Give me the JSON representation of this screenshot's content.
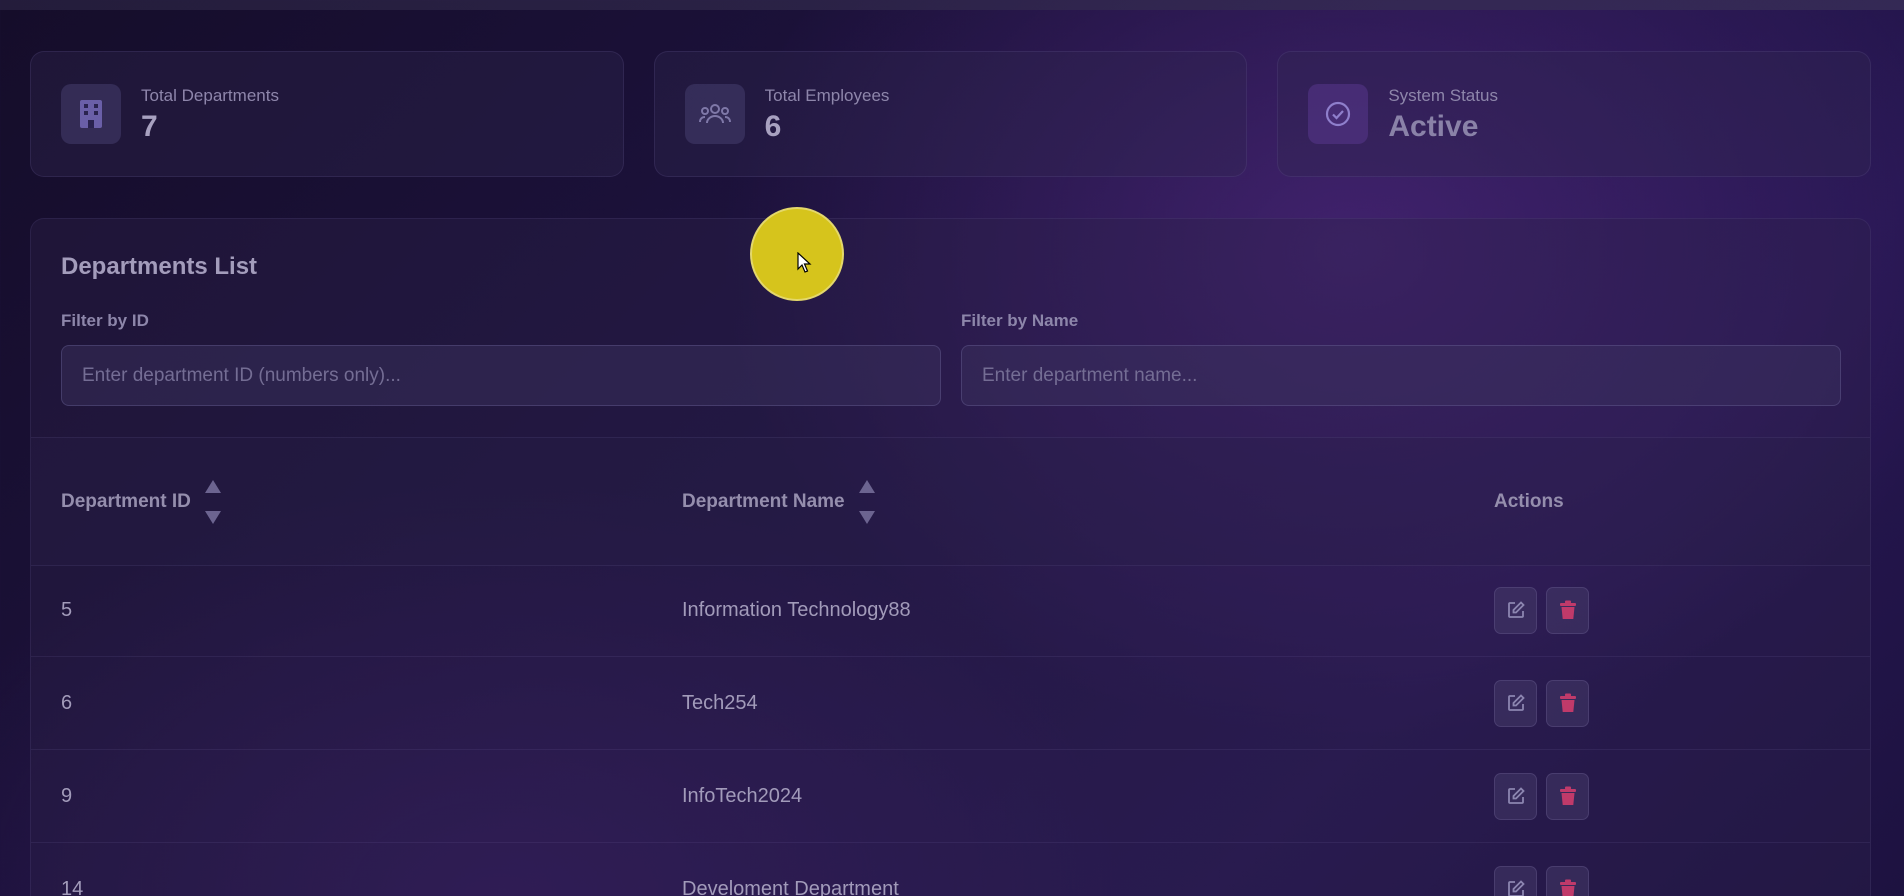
{
  "stats": [
    {
      "label": "Total Departments",
      "value": "7",
      "icon": "building-icon"
    },
    {
      "label": "Total Employees",
      "value": "6",
      "icon": "users-icon"
    },
    {
      "label": "System Status",
      "value": "Active",
      "icon": "check-circle-icon"
    }
  ],
  "panel": {
    "title": "Departments List",
    "filter_id_label": "Filter by ID",
    "filter_id_placeholder": "Enter department ID (numbers only)...",
    "filter_name_label": "Filter by Name",
    "filter_name_placeholder": "Enter department name..."
  },
  "table": {
    "headers": {
      "id": "Department ID",
      "name": "Department Name",
      "actions": "Actions"
    },
    "rows": [
      {
        "id": "5",
        "name": "Information Technology88"
      },
      {
        "id": "6",
        "name": "Tech254"
      },
      {
        "id": "9",
        "name": "InfoTech2024"
      },
      {
        "id": "14",
        "name": "Develoment Department"
      }
    ]
  },
  "colors": {
    "accent": "#6c4fb0",
    "delete": "#c03a6a",
    "edit": "#8c86b0",
    "cursor_highlight": "#d6c41c"
  }
}
